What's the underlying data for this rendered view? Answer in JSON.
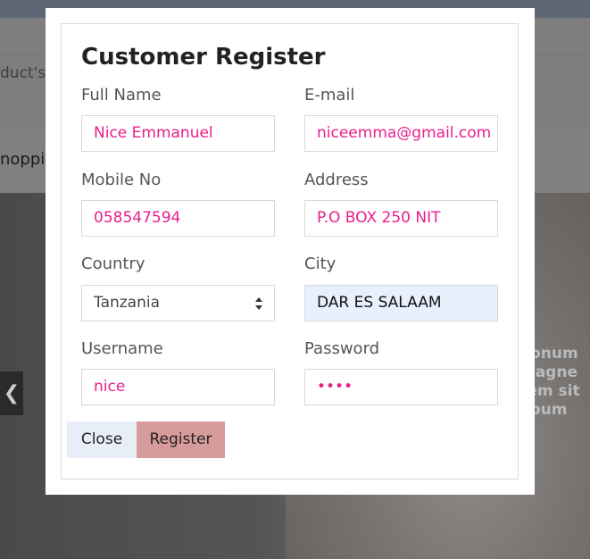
{
  "background": {
    "nav_partial_text": "duct's",
    "menu_partial_text": "noppin",
    "hero_partial_text": [
      "nonum",
      "magne",
      "rem sit",
      "ebum"
    ],
    "carousel_prev_icon": "chevron-left-icon"
  },
  "modal": {
    "title": "Customer Register",
    "fields": {
      "full_name": {
        "label": "Full Name",
        "value": "Nice Emmanuel"
      },
      "email": {
        "label": "E-mail",
        "value": "niceemma@gmail.com"
      },
      "mobile": {
        "label": "Mobile No",
        "value": "058547594"
      },
      "address": {
        "label": "Address",
        "value": "P.O BOX 250 NIT"
      },
      "country": {
        "label": "Country",
        "value": "Tanzania"
      },
      "city": {
        "label": "City",
        "value": "DAR ES SALAAM"
      },
      "username": {
        "label": "Username",
        "value": "nice"
      },
      "password": {
        "label": "Password",
        "value": "••••"
      }
    },
    "buttons": {
      "close_label": "Close",
      "register_label": "Register"
    }
  },
  "colors": {
    "input_text": "#e91e8c",
    "autofill_bg": "#e8f0fe",
    "register_bg": "#d89b9b",
    "close_bg": "#e8eef8"
  }
}
